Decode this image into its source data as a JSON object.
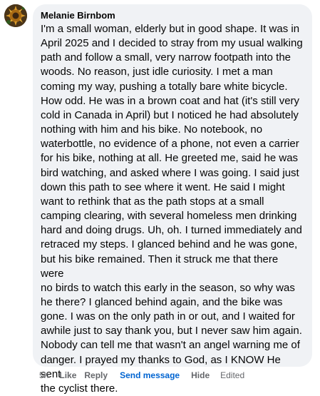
{
  "comment": {
    "author": "Melanie Birnbom",
    "avatar_icon": "profile-photo-icon",
    "lines": [
      "I'm a small woman, elderly but in good shape. It was in",
      "April 2025 and I decided to stray from my usual walking",
      "path and follow a small, very narrow footpath into the",
      "woods. No reason, just idle curiosity. I met a man",
      "coming my way, pushing a totally bare white bicycle.",
      "How odd. He was in a brown coat and hat (it's still very",
      "cold in Canada in April) but I noticed he had absolutely",
      "nothing with him and his bike. No notebook, no",
      "waterbottle, no evidence of a phone, not even a carrier",
      "for his bike, nothing at all. He greeted me, said he was",
      "bird watching, and asked where I was going. I said just",
      "down this path to see where it went. He said I might",
      "want to rethink that as the path stops at a small",
      "camping clearing, with several homeless men drinking",
      "hard and doing drugs. Uh, oh. I turned immediately and",
      "retraced my steps. I glanced behind and he was gone,",
      "but his bike remained. Then it struck me that there were",
      "no birds to watch this early in the season, so why was",
      "he there? I glanced behind again, and the bike was",
      "gone. I was on the only path in or out, and I waited for",
      "awhile just to say thank you, but I never saw him again.",
      "Nobody can tell me that wasn't an angel warning me of",
      "danger. I prayed my thanks to God, as I KNOW He sent",
      "the cyclist there."
    ]
  },
  "actions": {
    "time": "5h",
    "like": "Like",
    "reply": "Reply",
    "send_message": "Send message",
    "hide": "Hide",
    "edited": "Edited"
  },
  "colors": {
    "bubble_background": "#f0f2f5",
    "text": "#050505",
    "secondary_text": "#65676b",
    "link_blue": "#0064d1"
  }
}
